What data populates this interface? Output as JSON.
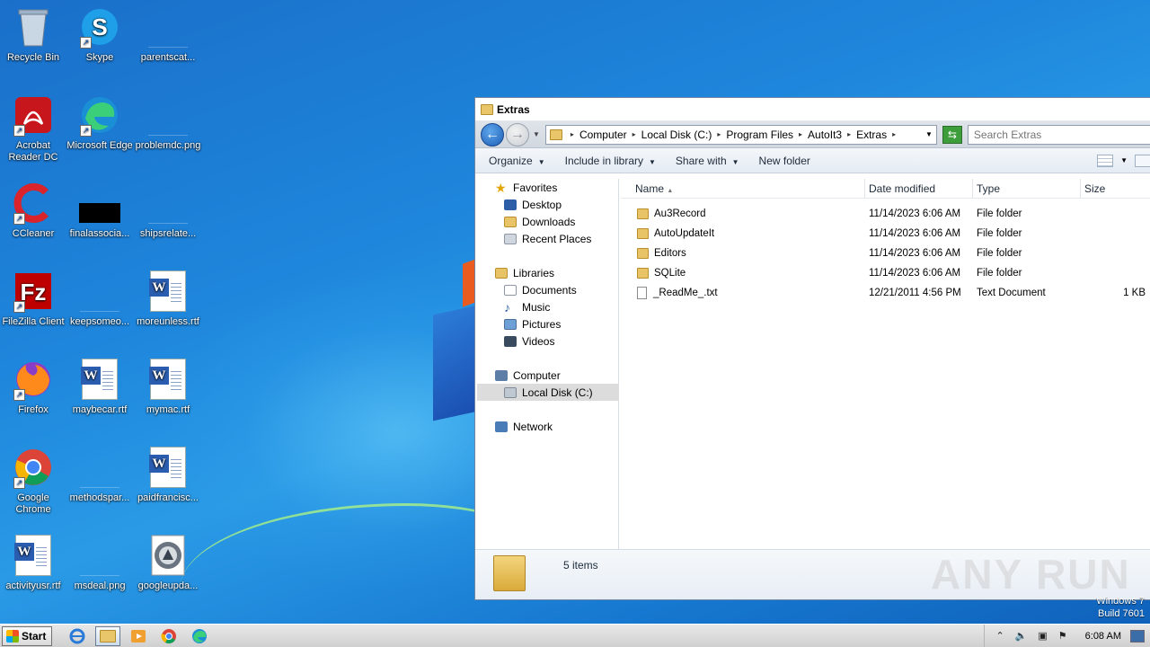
{
  "desktop": {
    "icons": [
      {
        "label": "Recycle Bin"
      },
      {
        "label": "Skype"
      },
      {
        "label": "parentscat..."
      },
      {
        "label": "Acrobat Reader DC"
      },
      {
        "label": "Microsoft Edge"
      },
      {
        "label": "problemdc.png"
      },
      {
        "label": "CCleaner"
      },
      {
        "label": "finalassocia..."
      },
      {
        "label": "shipsrelate..."
      },
      {
        "label": "FileZilla Client"
      },
      {
        "label": "keepsomeo..."
      },
      {
        "label": "moreunless.rtf"
      },
      {
        "label": "Firefox"
      },
      {
        "label": "maybecar.rtf"
      },
      {
        "label": "mymac.rtf"
      },
      {
        "label": "Google Chrome"
      },
      {
        "label": "methodspar..."
      },
      {
        "label": "paidfrancisc..."
      },
      {
        "label": "activityusr.rtf"
      },
      {
        "label": "msdeal.png"
      },
      {
        "label": "googleupda..."
      }
    ]
  },
  "explorer": {
    "title": "Extras",
    "breadcrumb": [
      "Computer",
      "Local Disk (C:)",
      "Program Files",
      "AutoIt3",
      "Extras"
    ],
    "search_placeholder": "Search Extras",
    "commands": {
      "organize": "Organize",
      "include_in_library": "Include in library",
      "share_with": "Share with",
      "new_folder": "New folder"
    },
    "nav": {
      "favorites": "Favorites",
      "desktop": "Desktop",
      "downloads": "Downloads",
      "recent_places": "Recent Places",
      "libraries": "Libraries",
      "documents": "Documents",
      "music": "Music",
      "pictures": "Pictures",
      "videos": "Videos",
      "computer": "Computer",
      "local_disk": "Local Disk (C:)",
      "network": "Network"
    },
    "columns": {
      "name": "Name",
      "date": "Date modified",
      "type": "Type",
      "size": "Size"
    },
    "files": [
      {
        "name": "Au3Record",
        "date": "11/14/2023 6:06 AM",
        "type": "File folder",
        "size": ""
      },
      {
        "name": "AutoUpdateIt",
        "date": "11/14/2023 6:06 AM",
        "type": "File folder",
        "size": ""
      },
      {
        "name": "Editors",
        "date": "11/14/2023 6:06 AM",
        "type": "File folder",
        "size": ""
      },
      {
        "name": "SQLite",
        "date": "11/14/2023 6:06 AM",
        "type": "File folder",
        "size": ""
      },
      {
        "name": "_ReadMe_.txt",
        "date": "12/21/2011 4:56 PM",
        "type": "Text Document",
        "size": "1 KB"
      }
    ],
    "status": "5 items"
  },
  "watermark": "ANY RUN",
  "os": {
    "line1": "Windows 7",
    "line2": "Build 7601"
  },
  "taskbar": {
    "start": "Start",
    "clock": "6:08 AM"
  },
  "colors": {
    "accent": "#1e86dc",
    "folder": "#e8c466"
  }
}
